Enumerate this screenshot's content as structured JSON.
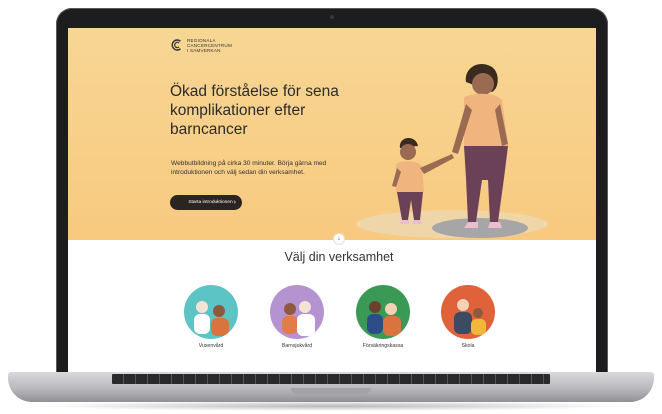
{
  "logo": {
    "lines": [
      "REGIONALA",
      "CANCERCENTRUM",
      "I SAMVERKAN"
    ]
  },
  "hero": {
    "title": "Ökad förståelse för sena komplikationer efter barncancer",
    "text": "Webbutbildning på cirka 30 minuter. Börja gärna med introduktionen och välj sedan din verksamhet.",
    "cta_label": "Starta introduktionen",
    "cta_icon": "chevron-right-icon",
    "background_color": "#f8cf88"
  },
  "section": {
    "title": "Välj din verksamhet",
    "down_icon": "arrow-down-icon"
  },
  "cards": [
    {
      "label": "Vuxenvård",
      "color": "#5cc4c4"
    },
    {
      "label": "Barnsjukvård",
      "color": "#b593d0"
    },
    {
      "label": "Försäkringskassa",
      "color": "#3a9a55"
    },
    {
      "label": "Skola",
      "color": "#e0623a"
    }
  ]
}
